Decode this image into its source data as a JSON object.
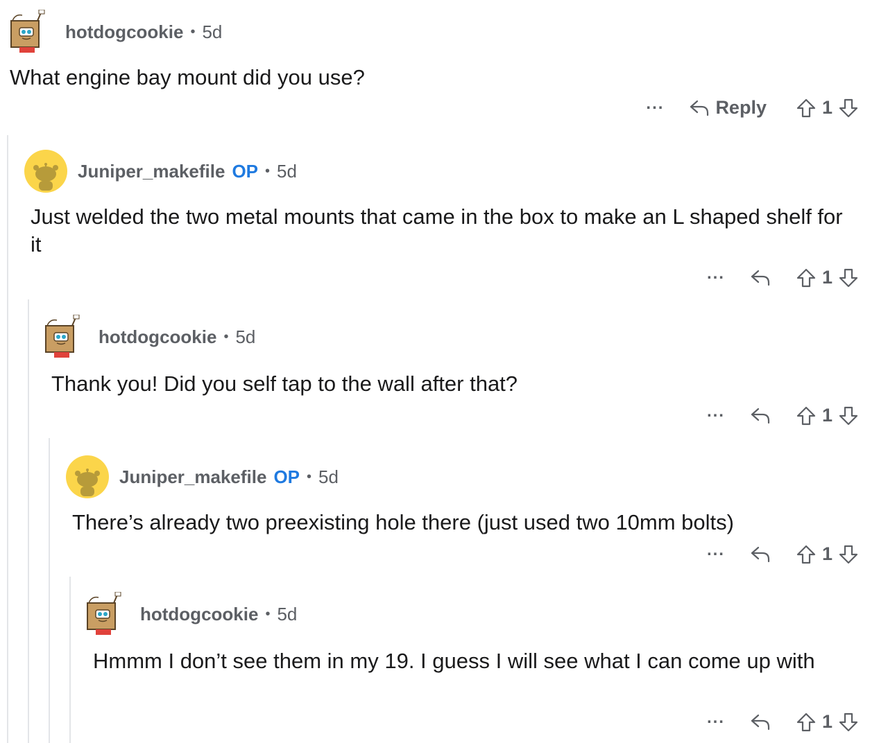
{
  "comments": [
    {
      "username": "hotdogcookie",
      "op_label": "",
      "separator": "•",
      "time": "5d",
      "body": "What engine bay mount did you use?",
      "avatar_icon": "cardboard-box-avatar-icon",
      "more_label": "...",
      "reply_label": "Reply",
      "score": "1"
    },
    {
      "username": "Juniper_makefile",
      "op_label": "OP",
      "separator": "•",
      "time": "5d",
      "body": "Just welded the two metal mounts that came in the box to make an L shaped shelf for it",
      "avatar_icon": "default-snoo-avatar-icon",
      "more_label": "...",
      "reply_label": "",
      "score": "1"
    },
    {
      "username": "hotdogcookie",
      "op_label": "",
      "separator": "•",
      "time": "5d",
      "body": "Thank you! Did you self tap to the wall after that?",
      "avatar_icon": "cardboard-box-avatar-icon",
      "more_label": "...",
      "reply_label": "",
      "score": "1"
    },
    {
      "username": "Juniper_makefile",
      "op_label": "OP",
      "separator": "•",
      "time": "5d",
      "body": "There’s already two preexisting hole there (just used two 10mm bolts)",
      "avatar_icon": "default-snoo-avatar-icon",
      "more_label": "...",
      "reply_label": "",
      "score": "1"
    },
    {
      "username": "hotdogcookie",
      "op_label": "",
      "separator": "•",
      "time": "5d",
      "body": "Hmmm I don’t see them in my 19. I guess I will see what I can come up with",
      "avatar_icon": "cardboard-box-avatar-icon",
      "more_label": "...",
      "reply_label": "",
      "score": "1"
    }
  ],
  "colors": {
    "text": "#1a1a1b",
    "meta": "#5c5f64",
    "op": "#1f7ae0",
    "thread_line": "#e3e5e8",
    "snoo_bg": "#fbd54a"
  }
}
